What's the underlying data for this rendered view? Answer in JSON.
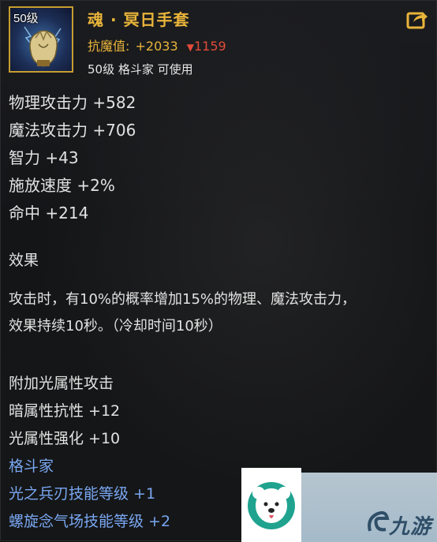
{
  "item": {
    "level_badge": "50级",
    "name": "魂 · 冥日手套",
    "resist_label": "抗魔值:",
    "resist_value": "+2033",
    "resist_change": "1159",
    "requirement": "50级 格斗家 可使用"
  },
  "stats": [
    "物理攻击力 +582",
    "魔法攻击力 +706",
    "智力 +43",
    "施放速度 +2%",
    "命中 +214"
  ],
  "effect": {
    "title": "效果",
    "lines": [
      "攻击时，有10%的概率增加15%的物理、魔法攻击力，",
      "效果持续10秒。（冷却时间10秒）"
    ]
  },
  "extras": [
    "附加光属性攻击",
    "暗属性抗性 +12",
    "光属性强化 +10"
  ],
  "class_restrictions": {
    "class_name": "格斗家",
    "skills": [
      "光之兵刃技能等级 +1",
      "螺旋念气场技能等级 +2"
    ]
  },
  "watermark": {
    "brand": "九游"
  },
  "colors": {
    "title_gold": "#e8b43a",
    "decrease_red": "#e24b3b",
    "class_blue": "#79a7f2",
    "text_main": "#e2e2e2",
    "frame_gold": "#c79d2f"
  },
  "icons": {
    "item": "glove-icon",
    "share": "share-arrow-icon",
    "decrease": "down-triangle-icon"
  }
}
